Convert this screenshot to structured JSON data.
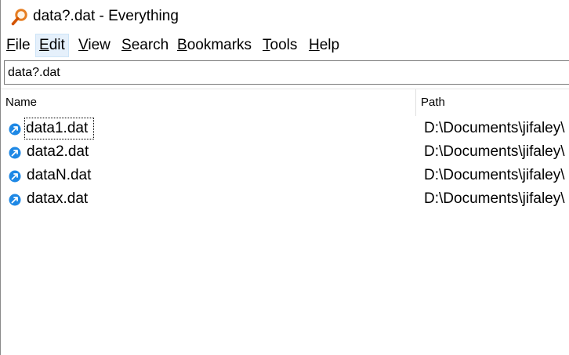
{
  "window": {
    "title": "data?.dat - Everything",
    "accent_color": "#e67e22"
  },
  "menu": {
    "file": {
      "letter": "F",
      "rest": "ile"
    },
    "edit": {
      "letter": "E",
      "rest": "dit"
    },
    "view": {
      "letter": "V",
      "rest": "iew"
    },
    "search": {
      "letter": "S",
      "rest": "earch"
    },
    "bookmarks": {
      "letter": "B",
      "rest": "ookmarks"
    },
    "tools": {
      "letter": "T",
      "rest": "ools"
    },
    "help": {
      "letter": "H",
      "rest": "elp"
    }
  },
  "search": {
    "value": "data?.dat"
  },
  "columns": {
    "name": "Name",
    "path": "Path"
  },
  "results": [
    {
      "name": "data1.dat",
      "path": "D:\\Documents\\jifaley\\",
      "icon": "file-link-icon"
    },
    {
      "name": "data2.dat",
      "path": "D:\\Documents\\jifaley\\",
      "icon": "file-link-icon"
    },
    {
      "name": "dataN.dat",
      "path": "D:\\Documents\\jifaley\\",
      "icon": "file-link-icon"
    },
    {
      "name": "datax.dat",
      "path": "D:\\Documents\\jifaley\\",
      "icon": "file-link-icon"
    }
  ],
  "colors": {
    "icon_blue": "#1e88e5",
    "menu_highlight": "#e5f0fb"
  }
}
